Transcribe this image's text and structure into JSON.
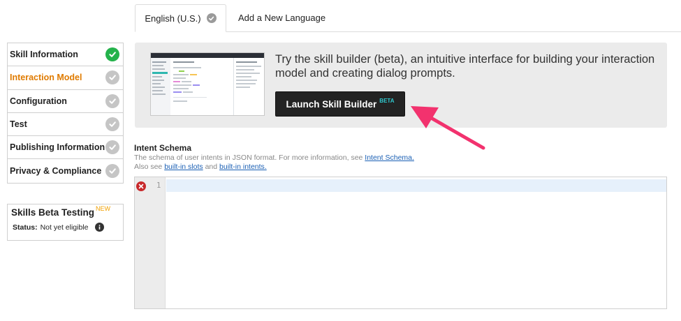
{
  "tabs": {
    "active_label": "English (U.S.)",
    "add_label": "Add a New Language"
  },
  "sidebar": {
    "steps": [
      {
        "label": "Skill Information",
        "status": "complete"
      },
      {
        "label": "Interaction Model",
        "status": "current"
      },
      {
        "label": "Configuration",
        "status": "incomplete"
      },
      {
        "label": "Test",
        "status": "incomplete"
      },
      {
        "label": "Publishing Information",
        "status": "incomplete"
      },
      {
        "label": "Privacy & Compliance",
        "status": "incomplete"
      }
    ],
    "beta_testing": {
      "title": "Skills Beta Testing",
      "badge": "NEW",
      "status_label": "Status:",
      "status_value": "Not yet eligible"
    }
  },
  "promo": {
    "text": "Try the skill builder (beta), an intuitive interface for building your interaction model and creating dialog prompts.",
    "button_label": "Launch Skill Builder",
    "button_badge": "BETA"
  },
  "intent_schema": {
    "title": "Intent Schema",
    "desc_prefix": "The schema of user intents in JSON format. For more information, see ",
    "desc_link": "Intent Schema.",
    "desc2_prefix": "Also see ",
    "desc2_link1": "built-in slots",
    "desc2_mid": " and ",
    "desc2_link2": "built-in intents.",
    "line_number": "1"
  },
  "colors": {
    "current_step": "#e07b00",
    "complete_check": "#24b24b",
    "incomplete_check": "#c5c5c5",
    "new_badge": "#f0a000",
    "beta_badge": "#2fc9cf",
    "arrow": "#f2326e",
    "link": "#1a5fb4",
    "error": "#c8282a"
  },
  "icons": {
    "tab_check": "check-circle-icon",
    "step_check": "check-circle-icon",
    "info": "info-icon",
    "error": "error-icon",
    "arrow": "arrow-icon"
  }
}
